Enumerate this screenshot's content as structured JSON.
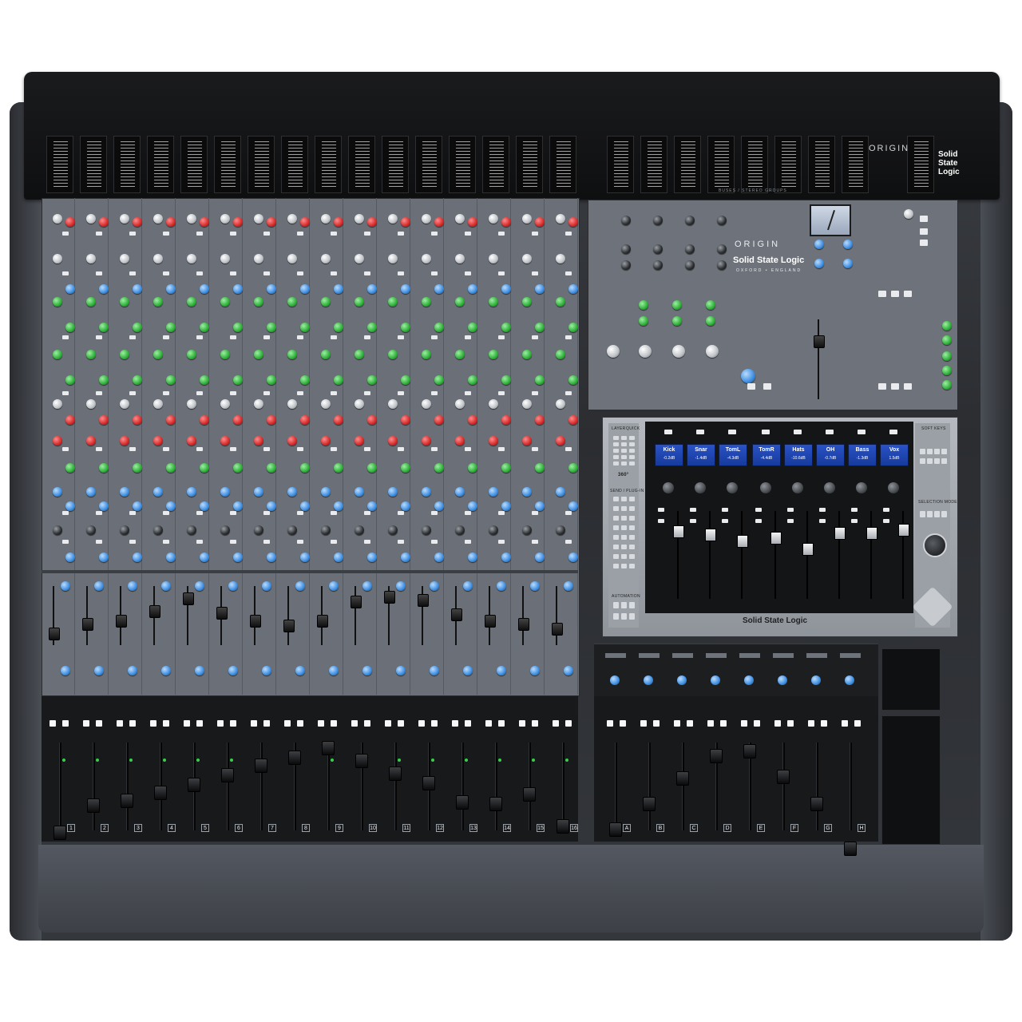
{
  "product": {
    "brand_lines": [
      "Solid",
      "State",
      "Logic"
    ],
    "brand_full": "Solid State Logic",
    "model": "ORIGIN",
    "origin_sub": "OXFORD • ENGLAND"
  },
  "meter_bridge": {
    "caption": "BUSES / STEREO GROUPS"
  },
  "daw_controller": {
    "left_labels": [
      "LAYER",
      "QUICK",
      "360°",
      "SEND / PLUG-IN",
      "AUTOMATION"
    ],
    "right_labels": [
      "SOFT KEYS",
      "SELECTION MODE"
    ],
    "channels": [
      {
        "name": "Kick",
        "value": "-0.2dB"
      },
      {
        "name": "Snar",
        "value": "-1.4dB"
      },
      {
        "name": "TomL",
        "value": "-4.3dB"
      },
      {
        "name": "TomR",
        "value": "-4.4dB"
      },
      {
        "name": "Hats",
        "value": "-10.6dB"
      },
      {
        "name": "OH",
        "value": "-0.7dB"
      },
      {
        "name": "Bass",
        "value": "-1.3dB"
      },
      {
        "name": "Vox",
        "value": "1.5dB"
      }
    ],
    "logo": "Solid State Logic"
  },
  "channel_numbers": [
    "1",
    "2",
    "3",
    "4",
    "5",
    "6",
    "7",
    "8",
    "9",
    "10",
    "11",
    "12",
    "13",
    "14",
    "15",
    "16"
  ],
  "group_letters": [
    "A",
    "B",
    "C",
    "D",
    "E",
    "F",
    "G",
    "H"
  ],
  "colors": {
    "panel": "#6b7078",
    "lcd": "#2a52c6",
    "knob_red": "#d42b2b",
    "knob_green": "#2fae3a",
    "knob_blue": "#3f8ee0",
    "knob_grey": "#bfc3c8"
  }
}
